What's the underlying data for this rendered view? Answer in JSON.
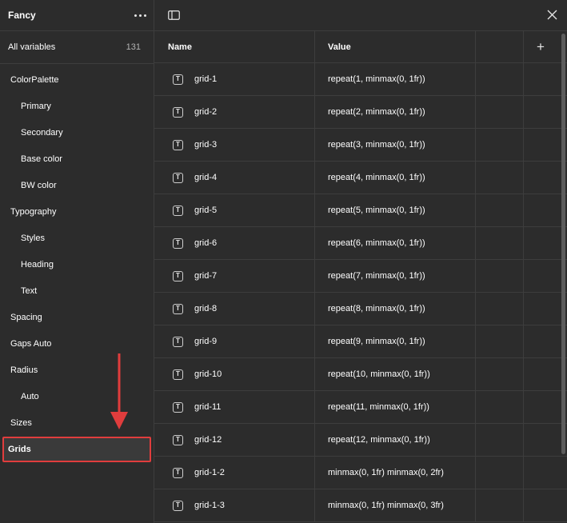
{
  "sidebar": {
    "title": "Fancy",
    "all_variables": {
      "label": "All variables",
      "count": "131"
    },
    "groups": [
      {
        "label": "ColorPalette",
        "level": 0
      },
      {
        "label": "Primary",
        "level": 1
      },
      {
        "label": "Secondary",
        "level": 1
      },
      {
        "label": "Base color",
        "level": 1
      },
      {
        "label": "BW color",
        "level": 1
      },
      {
        "label": "Typography",
        "level": 0
      },
      {
        "label": "Styles",
        "level": 1
      },
      {
        "label": "Heading",
        "level": 1
      },
      {
        "label": "Text",
        "level": 1
      },
      {
        "label": "Spacing",
        "level": 0
      },
      {
        "label": "Gaps Auto",
        "level": 0
      },
      {
        "label": "Radius",
        "level": 0
      },
      {
        "label": "Auto",
        "level": 1
      },
      {
        "label": "Sizes",
        "level": 0
      },
      {
        "label": "Grids",
        "level": 0,
        "selected": true
      }
    ]
  },
  "table": {
    "columns": {
      "name": "Name",
      "value": "Value",
      "add": "+"
    },
    "type_icon_glyph": "T",
    "rows": [
      {
        "name": "grid-1",
        "value": "repeat(1, minmax(0, 1fr))"
      },
      {
        "name": "grid-2",
        "value": "repeat(2, minmax(0, 1fr))"
      },
      {
        "name": "grid-3",
        "value": "repeat(3, minmax(0, 1fr))"
      },
      {
        "name": "grid-4",
        "value": "repeat(4, minmax(0, 1fr))"
      },
      {
        "name": "grid-5",
        "value": "repeat(5, minmax(0, 1fr))"
      },
      {
        "name": "grid-6",
        "value": "repeat(6, minmax(0, 1fr))"
      },
      {
        "name": "grid-7",
        "value": "repeat(7, minmax(0, 1fr))"
      },
      {
        "name": "grid-8",
        "value": "repeat(8, minmax(0, 1fr))"
      },
      {
        "name": "grid-9",
        "value": "repeat(9, minmax(0, 1fr))"
      },
      {
        "name": "grid-10",
        "value": "repeat(10, minmax(0, 1fr))"
      },
      {
        "name": "grid-11",
        "value": "repeat(11, minmax(0, 1fr))"
      },
      {
        "name": "grid-12",
        "value": "repeat(12, minmax(0, 1fr))"
      },
      {
        "name": "grid-1-2",
        "value": "minmax(0, 1fr) minmax(0, 2fr)"
      },
      {
        "name": "grid-1-3",
        "value": "minmax(0, 1fr) minmax(0, 3fr)"
      }
    ]
  },
  "colors": {
    "background": "#2c2c2c",
    "divider": "#3d3d3d",
    "highlight": "#e03d3d",
    "text": "#ffffff"
  },
  "icons": {
    "sidebar_more": "more-horizontal-icon",
    "toggle_panel": "sidebar-panel-icon",
    "close": "close-icon",
    "add": "plus-icon",
    "row_type": "text-type-icon",
    "annotation": "down-arrow-icon"
  }
}
